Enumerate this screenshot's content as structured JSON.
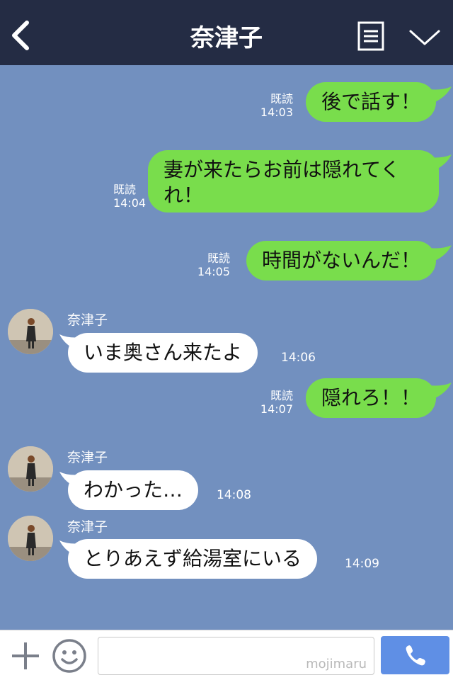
{
  "header": {
    "title": "奈津子",
    "back_icon": "chevron-left-icon",
    "menu_icon": "list-menu-icon",
    "collapse_icon": "chevron-down-icon",
    "background": "#242c44"
  },
  "colors": {
    "chat_background": "#7290bf",
    "sent_bubble": "#79dd4c",
    "received_bubble": "#ffffff",
    "call_button": "#5f8fe5"
  },
  "messages": [
    {
      "direction": "sent",
      "text": "後で話す！",
      "read": "既読",
      "time": "14:03"
    },
    {
      "direction": "sent",
      "text_line1": "妻が来たらお前は隠れてく",
      "text_line2": "れ！",
      "read": "既読",
      "time": "14:04"
    },
    {
      "direction": "sent",
      "text": "時間がないんだ！",
      "read": "既読",
      "time": "14:05"
    },
    {
      "direction": "received",
      "sender": "奈津子",
      "text": "いま奥さん来たよ",
      "time": "14:06"
    },
    {
      "direction": "sent",
      "text": "隠れろ！！",
      "read": "既読",
      "time": "14:07"
    },
    {
      "direction": "received",
      "sender": "奈津子",
      "text": "わかった…",
      "time": "14:08"
    },
    {
      "direction": "received",
      "sender": "奈津子",
      "text": "とりあえず給湯室にいる",
      "time": "14:09"
    }
  ],
  "input_bar": {
    "plus_icon": "plus-icon",
    "emoji_icon": "smiley-icon",
    "watermark": "mojimaru",
    "call_icon": "phone-icon"
  }
}
